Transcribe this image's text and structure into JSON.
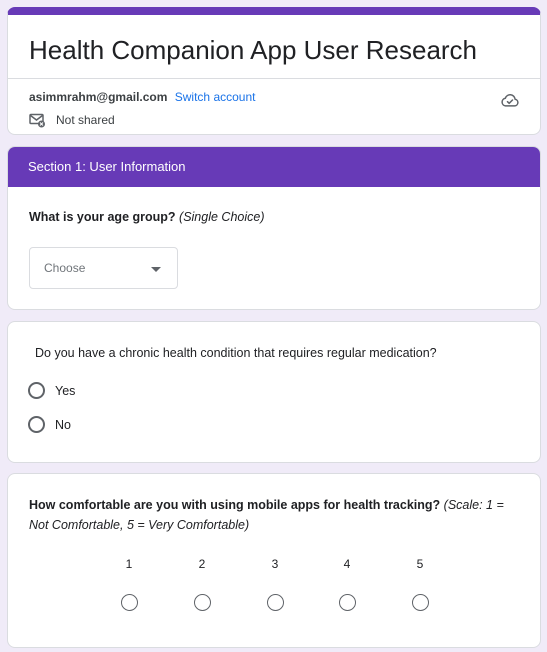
{
  "form": {
    "title": "Health Companion App User Research",
    "account_email": "asimmrahm@gmail.com",
    "switch_account": "Switch account",
    "not_shared": "Not shared",
    "accent_color": "#673ab7"
  },
  "section": {
    "title": "Section 1: User Information"
  },
  "q1": {
    "title": "What is your age group?",
    "hint": "(Single Choice)",
    "dropdown_value": "Choose"
  },
  "q2": {
    "title": "Do you have a chronic health condition that requires regular medication?",
    "options": [
      "Yes",
      "No"
    ]
  },
  "q3": {
    "title": "How comfortable are you with using mobile apps for health tracking?",
    "hint": "(Scale: 1 = Not Comfortable, 5 = Very Comfortable)",
    "scale": [
      "1",
      "2",
      "3",
      "4",
      "5"
    ]
  }
}
